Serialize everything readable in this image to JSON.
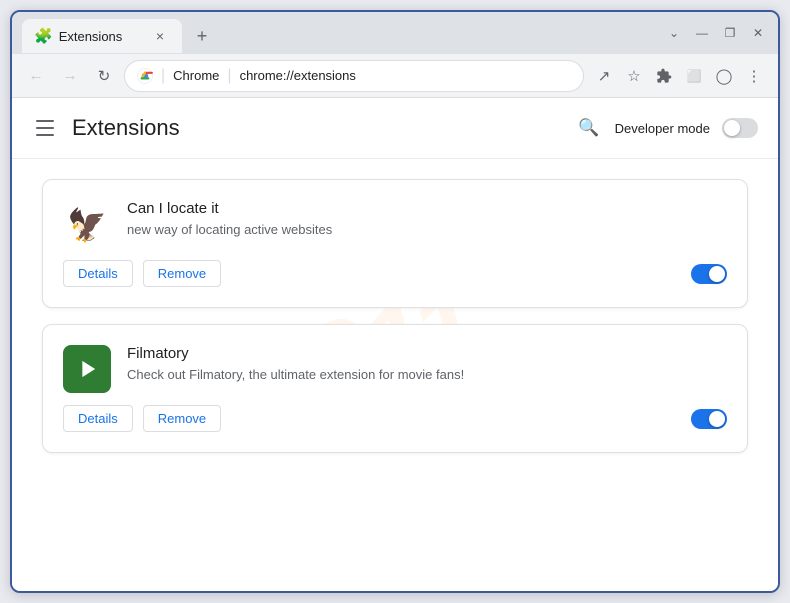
{
  "window": {
    "tab_title": "Extensions",
    "tab_close": "×",
    "new_tab": "+",
    "win_minimize": "—",
    "win_restore": "❐",
    "win_close": "✕",
    "win_dropdown": "⌄"
  },
  "navbar": {
    "back": "←",
    "forward": "→",
    "refresh": "↻",
    "chrome_label": "Chrome",
    "address": "chrome://extensions",
    "share_icon": "↗",
    "bookmark_icon": "☆",
    "extensions_icon": "⬡",
    "tab_icon": "⬜",
    "profile_icon": "◯",
    "more_icon": "⋮"
  },
  "page": {
    "menu_icon": "☰",
    "title": "Extensions",
    "search_icon": "🔍",
    "developer_mode_label": "Developer mode"
  },
  "extensions": [
    {
      "name": "Can I locate it",
      "description": "new way of locating active websites",
      "details_label": "Details",
      "remove_label": "Remove",
      "enabled": true
    },
    {
      "name": "Filmatory",
      "description": "Check out Filmatory, the ultimate extension for movie fans!",
      "details_label": "Details",
      "remove_label": "Remove",
      "enabled": true
    }
  ],
  "watermark": "911"
}
